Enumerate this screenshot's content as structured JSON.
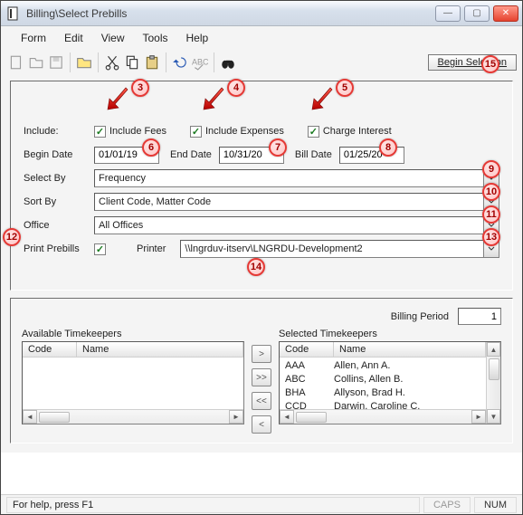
{
  "window": {
    "title": "Billing\\Select Prebills"
  },
  "menu": {
    "items": [
      "Form",
      "Edit",
      "View",
      "Tools",
      "Help"
    ]
  },
  "toolbar": {
    "begin_selection_label": "Begin Selection"
  },
  "form": {
    "include_label": "Include:",
    "include_fees": {
      "label": "Include Fees",
      "checked": true
    },
    "include_expenses": {
      "label": "Include Expenses",
      "checked": true
    },
    "charge_interest": {
      "label": "Charge Interest",
      "checked": true
    },
    "begin_date": {
      "label": "Begin Date",
      "value": "01/01/19"
    },
    "end_date": {
      "label": "End Date",
      "value": "10/31/20"
    },
    "bill_date": {
      "label": "Bill Date",
      "value": "01/25/20"
    },
    "select_by": {
      "label": "Select By",
      "value": "Frequency"
    },
    "sort_by": {
      "label": "Sort By",
      "value": "Client Code, Matter Code"
    },
    "office": {
      "label": "Office",
      "value": "All Offices"
    },
    "print_prebills": {
      "label": "Print Prebills",
      "checked": true
    },
    "printer": {
      "label": "Printer",
      "value": "\\\\lngrduv-itserv\\LNGRDU-Development2"
    }
  },
  "tk_panel": {
    "billing_period_label": "Billing Period",
    "billing_period_value": "1",
    "available_title": "Available Timekeepers",
    "selected_title": "Selected Timekeepers",
    "headers": {
      "code": "Code",
      "name": "Name"
    },
    "selected": [
      {
        "code": "AAA",
        "name": "Allen, Ann A."
      },
      {
        "code": "ABC",
        "name": "Collins, Allen B."
      },
      {
        "code": "BHA",
        "name": "Allyson, Brad H."
      },
      {
        "code": "CCD",
        "name": "Darwin, Caroline C."
      }
    ]
  },
  "statusbar": {
    "help_text": "For help, press F1",
    "caps": "CAPS",
    "num": "NUM"
  },
  "callouts": {
    "3": "3",
    "4": "4",
    "5": "5",
    "6": "6",
    "7": "7",
    "8": "8",
    "9": "9",
    "10": "10",
    "11": "11",
    "12": "12",
    "13": "13",
    "14": "14",
    "15": "15"
  }
}
